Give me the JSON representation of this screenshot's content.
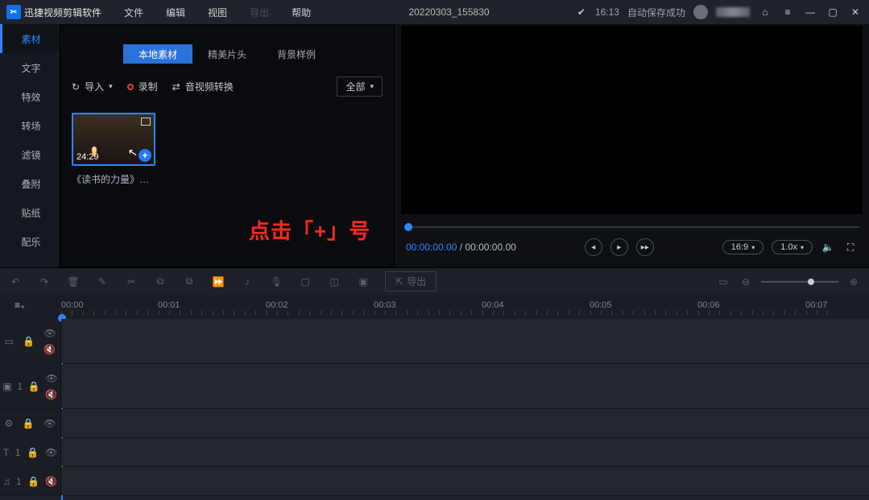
{
  "titlebar": {
    "app_name": "迅捷视频剪辑软件",
    "menus": {
      "file": "文件",
      "edit": "编辑",
      "view": "视图",
      "export": "导出",
      "help": "帮助"
    },
    "project_name": "20220303_155830",
    "autosave_time": "16:13",
    "autosave_label": "自动保存成功"
  },
  "sidebar": {
    "items": [
      "素材",
      "文字",
      "特效",
      "转场",
      "滤镜",
      "叠附",
      "贴纸",
      "配乐"
    ]
  },
  "panel": {
    "tabs": {
      "local": "本地素材",
      "beautiful": "精美片头",
      "bgsample": "背景样例"
    },
    "import_label": "导入",
    "record_label": "录制",
    "convert_label": "音视频转换",
    "filter_all": "全部",
    "thumb_duration": "24:29",
    "thumb_title": "《读书的力量》国...",
    "hint": "点击「+」号"
  },
  "preview": {
    "time_current": "00:00:00.00",
    "time_total": "00:00:00.00",
    "aspect": "16:9",
    "speed": "1.0x"
  },
  "timeline": {
    "export_label": "导出",
    "marks": [
      "00:00",
      "00:01",
      "00:02",
      "00:03",
      "00:04",
      "00:05",
      "00:06",
      "00:07"
    ]
  }
}
